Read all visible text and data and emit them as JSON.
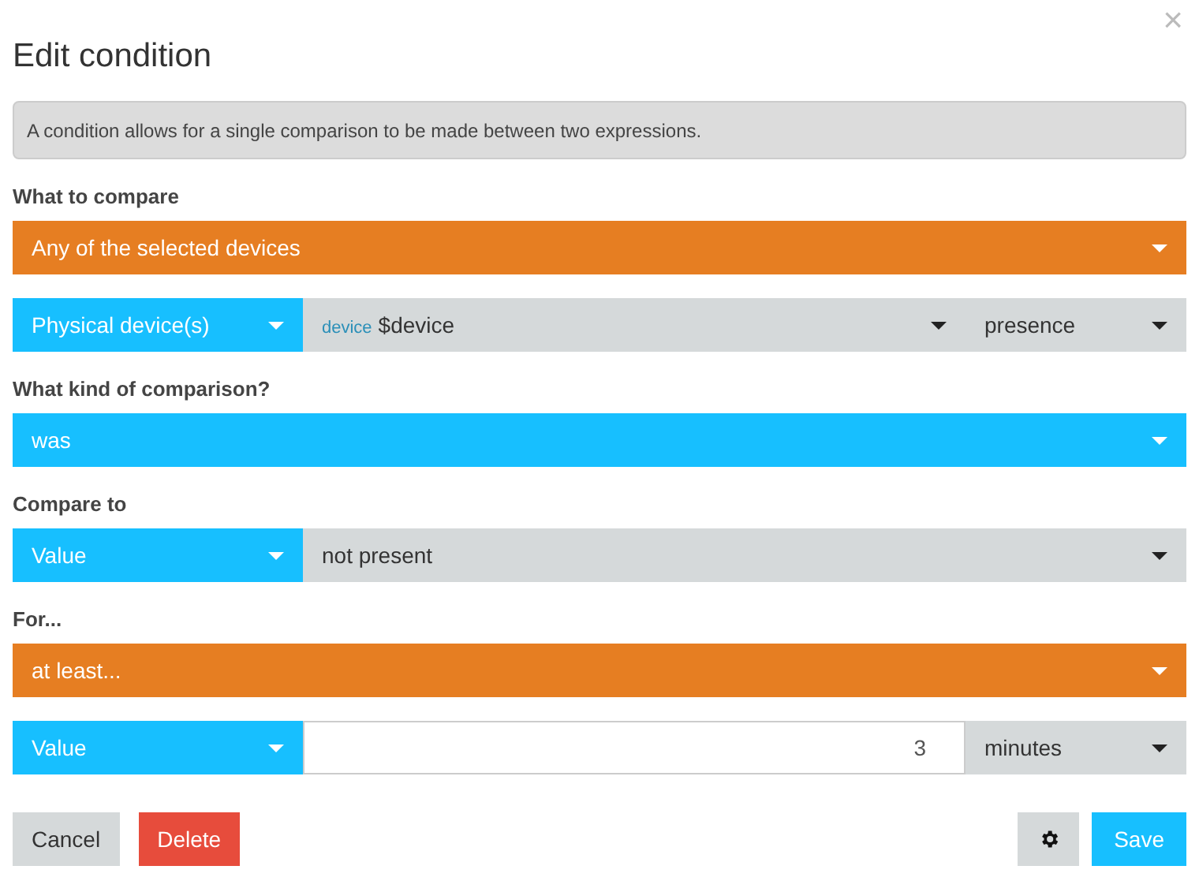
{
  "dialog": {
    "title": "Edit condition",
    "close": "×",
    "info": "A condition allows for a single comparison to be made between two expressions."
  },
  "sections": [
    {
      "label": "What to compare",
      "rows": [
        [
          {
            "kind": "select",
            "color": "#e67e22",
            "value": "Any of the selected devices"
          }
        ],
        [
          {
            "kind": "select",
            "color": "#17bfff",
            "value": "Physical device(s)"
          },
          {
            "kind": "select",
            "color": "#d5d9da",
            "tag": "device",
            "value": "$device"
          },
          {
            "kind": "select",
            "color": "#d5d9da",
            "value": "presence"
          }
        ]
      ]
    },
    {
      "label": "What kind of comparison?",
      "rows": [
        [
          {
            "kind": "select",
            "color": "#17bfff",
            "value": "was"
          }
        ]
      ]
    },
    {
      "label": "Compare to",
      "rows": [
        [
          {
            "kind": "select",
            "color": "#17bfff",
            "value": "Value"
          },
          {
            "kind": "select",
            "color": "#d5d9da",
            "value": "not present"
          }
        ]
      ]
    },
    {
      "label": "For...",
      "rows": [
        [
          {
            "kind": "select",
            "color": "#e67e22",
            "value": "at least..."
          }
        ],
        [
          {
            "kind": "select",
            "color": "#17bfff",
            "value": "Value"
          },
          {
            "kind": "input",
            "value": "3"
          },
          {
            "kind": "select",
            "color": "#d5d9da",
            "value": "minutes"
          }
        ]
      ]
    }
  ],
  "footer": {
    "cancel": "Cancel",
    "delete": "Delete",
    "save": "Save"
  }
}
